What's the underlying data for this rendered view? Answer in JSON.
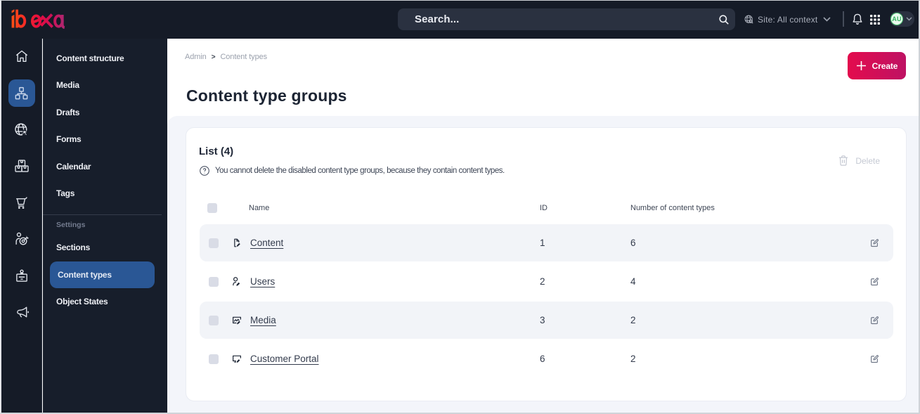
{
  "topbar": {
    "logo": "ibexa",
    "search_placeholder": "Search...",
    "site_context": "Site: All context",
    "avatar_initials": "AU",
    "icons": [
      "search-icon",
      "globe-icon",
      "bell-icon",
      "app-grid-icon",
      "chevron-down-icon"
    ]
  },
  "iconbar": {
    "items": [
      {
        "name": "dashboard",
        "icon": "home-icon"
      },
      {
        "name": "content",
        "icon": "sitemap-icon",
        "active": true
      },
      {
        "name": "site-management",
        "icon": "globe-cursor-icon"
      },
      {
        "name": "product-catalog",
        "icon": "boxes-icon"
      },
      {
        "name": "commerce",
        "icon": "cart-icon"
      },
      {
        "name": "personalization",
        "icon": "person-target-icon"
      },
      {
        "name": "admin",
        "icon": "badge-icon"
      },
      {
        "name": "marketing",
        "icon": "megaphone-icon"
      }
    ],
    "active_color": "#2a5795"
  },
  "sidebar": {
    "items": [
      {
        "label": "Content structure"
      },
      {
        "label": "Media"
      },
      {
        "label": "Drafts"
      },
      {
        "label": "Forms"
      },
      {
        "label": "Calendar"
      },
      {
        "label": "Tags"
      }
    ],
    "settings_label": "Settings",
    "settings_items": [
      {
        "label": "Sections"
      },
      {
        "label": "Content types",
        "active": true
      },
      {
        "label": "Object States"
      }
    ],
    "active_color": "#2a5795"
  },
  "breadcrumb": {
    "items": [
      "Admin",
      "Content types"
    ],
    "separator": ">"
  },
  "page": {
    "title": "Content type groups",
    "create_label": "Create"
  },
  "list": {
    "title": "List (4)",
    "help_text": "You cannot delete the disabled content type groups, because they contain content types.",
    "delete_label": "Delete"
  },
  "table": {
    "headers": [
      "Name",
      "ID",
      "Number of content types"
    ],
    "rows": [
      {
        "name": "Content",
        "icon": "file-edit-icon",
        "id": "1",
        "count": "6"
      },
      {
        "name": "Users",
        "icon": "user-edit-icon",
        "id": "2",
        "count": "4"
      },
      {
        "name": "Media",
        "icon": "image-edit-icon",
        "id": "3",
        "count": "2"
      },
      {
        "name": "Customer Portal",
        "icon": "monitor-edit-icon",
        "id": "6",
        "count": "2"
      }
    ]
  },
  "colors": {
    "topbar_bg": "#151b27",
    "sidebar_bg": "#171e2b",
    "accent_blue": "#2a5795",
    "create_gradient_start": "#e30b4d",
    "create_gradient_end": "#be1263",
    "panel_bg": "#f3f5fa",
    "row_alt_bg": "#f2f4f8",
    "avatar_green": "#4ec273"
  }
}
